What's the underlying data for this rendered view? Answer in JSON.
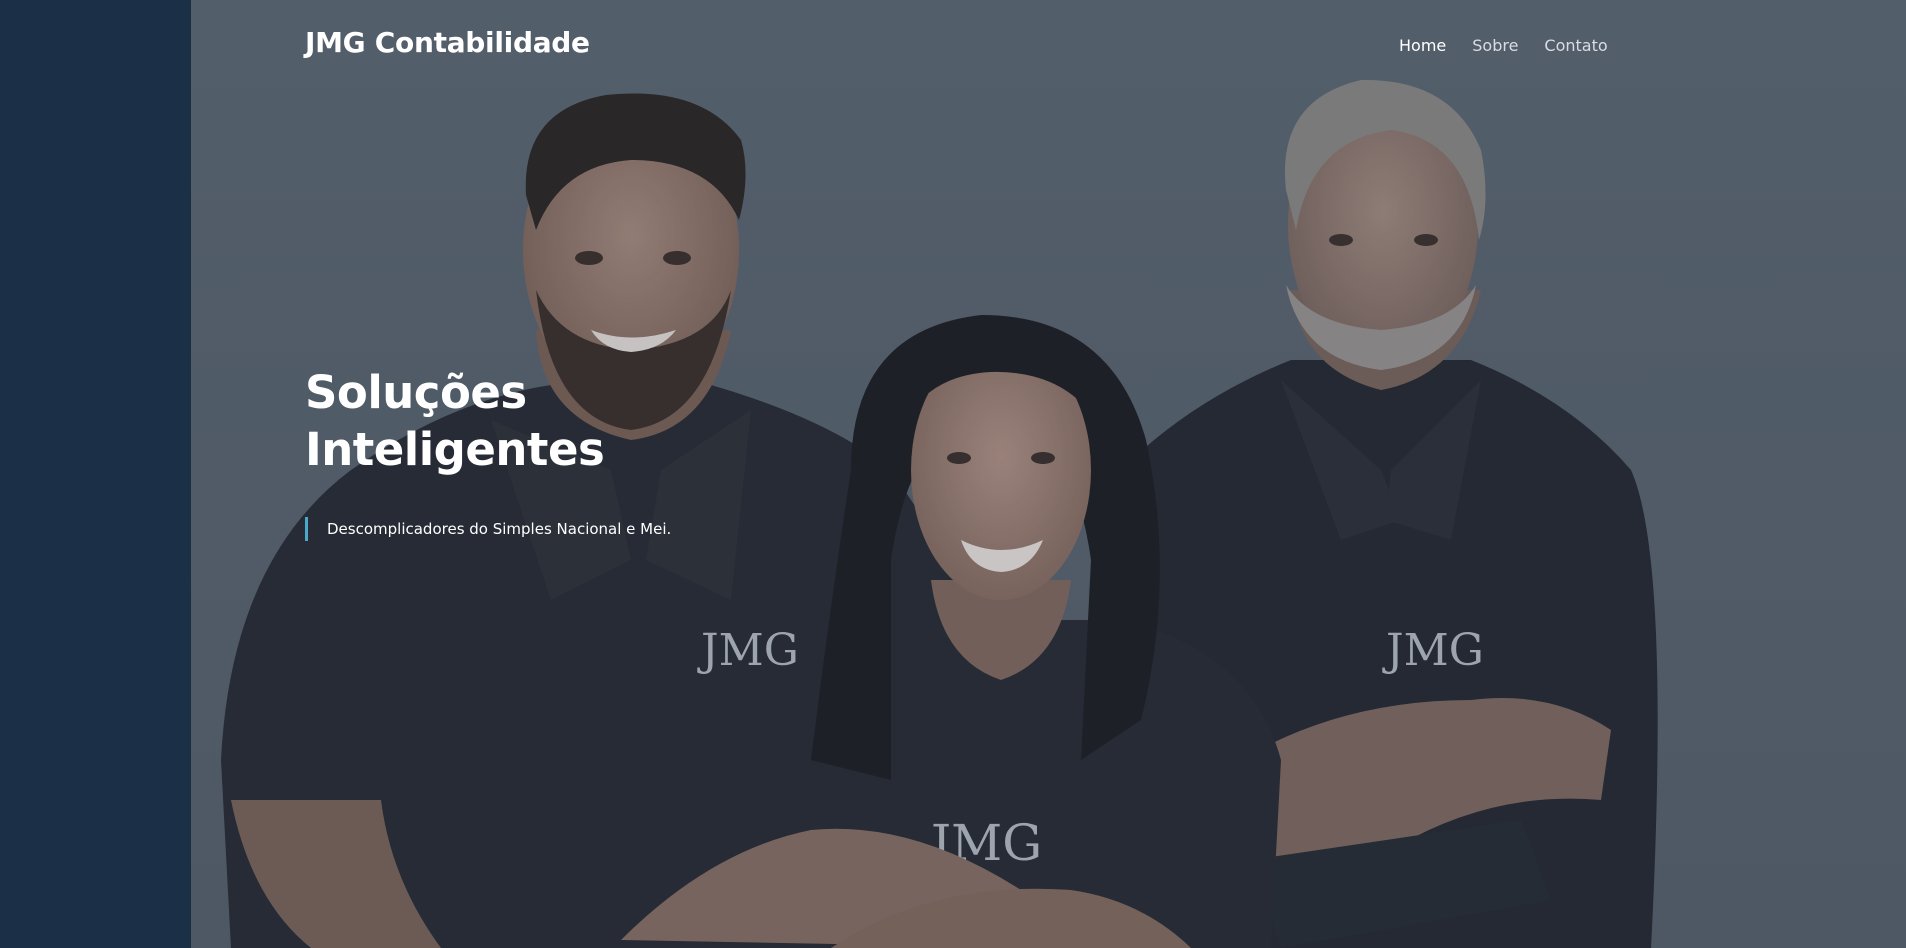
{
  "brand": {
    "name": "JMG Contabilidade"
  },
  "nav": {
    "items": [
      {
        "label": "Home",
        "active": true
      },
      {
        "label": "Sobre",
        "active": false
      },
      {
        "label": "Contato",
        "active": false
      }
    ]
  },
  "hero": {
    "headline_line1": "Soluções",
    "headline_line2": "Inteligentes",
    "tagline": "Descomplicadores do Simples Nacional e Mei.",
    "shirt_logo_text": "JMG"
  },
  "colors": {
    "sidebar_band": "#1b2f47",
    "accent_bar": "#4aa8c8",
    "hero_overlay": "#5b6571",
    "shirt": "#22262e"
  }
}
